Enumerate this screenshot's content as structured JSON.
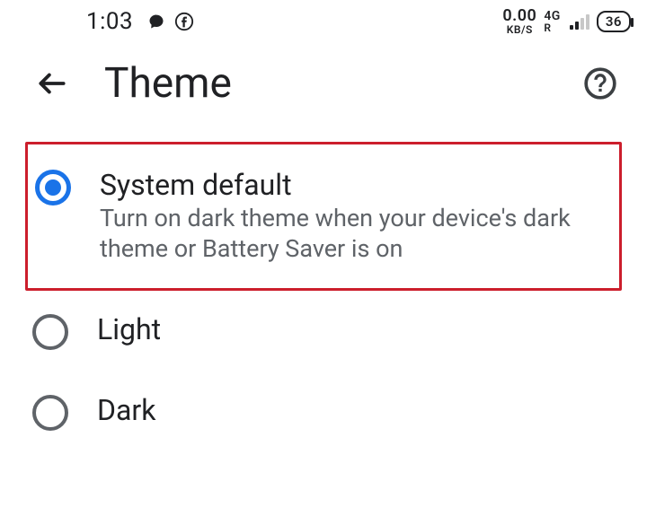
{
  "status": {
    "time": "1:03",
    "speed_value": "0.00",
    "speed_unit": "KB/S",
    "net_gen": "4G",
    "net_roam": "R",
    "battery": "36"
  },
  "appbar": {
    "title": "Theme"
  },
  "options": {
    "system_default": {
      "title": "System default",
      "subtitle": "Turn on dark theme when your device's dark theme or Battery Saver is on",
      "selected": true
    },
    "light": {
      "title": "Light",
      "selected": false
    },
    "dark": {
      "title": "Dark",
      "selected": false
    }
  }
}
